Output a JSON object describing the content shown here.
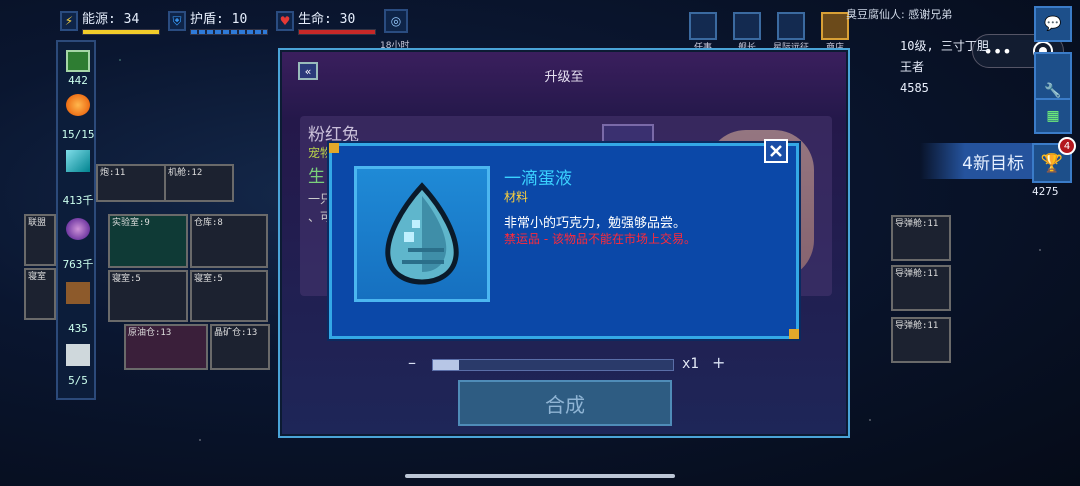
{
  "hud": {
    "energy_label": "能源: 34",
    "shield_label": "护盾: 10",
    "life_label": "生命: 30",
    "timer_label": "18小时"
  },
  "top_tools": [
    {
      "label": "任事"
    },
    {
      "label": "舰长"
    },
    {
      "label": "星际远征"
    },
    {
      "label": "商店"
    }
  ],
  "left_resources": [
    {
      "value": "442"
    },
    {
      "value": "15/15"
    },
    {
      "value": "413千"
    },
    {
      "value": "763千"
    },
    {
      "value": "435"
    },
    {
      "value": "5/5"
    }
  ],
  "ship_rooms": [
    {
      "label": "炮:11"
    },
    {
      "label": "机舱:12"
    },
    {
      "label": "实验室:9"
    },
    {
      "label": "仓库:8"
    },
    {
      "label": "寝室:5"
    },
    {
      "label": "寝室:5"
    },
    {
      "label": "原油仓:13"
    },
    {
      "label": "晶矿仓:13"
    },
    {
      "label": "联盟"
    },
    {
      "label": "寝室"
    }
  ],
  "right_ship_rooms": [
    {
      "label": "导弹舱:11"
    },
    {
      "label": "导弹舱:11"
    },
    {
      "label": "导弹舱:11"
    }
  ],
  "user": {
    "greeting": "臭豆腐仙人: 感谢兄弟",
    "rank_level": "10级, 三寸丁胆",
    "rank_title": "王者",
    "score": "4585",
    "new_goals": "4新目标",
    "goal_badge": "4",
    "trophies": "4275"
  },
  "upgrade_dialog": {
    "title": "升级至",
    "pet_name": "粉红兔",
    "pet_subtitle": "宠物",
    "pet_big": "生",
    "pet_desc": "一只\n、可",
    "quantity": "x1",
    "craft_label": "合成"
  },
  "item_tooltip": {
    "name": "一滴蛋液",
    "type": "材料",
    "description": "非常小的巧克力，勉强够品尝。",
    "warning": "禁运品 - 该物品不能在市场上交易。"
  }
}
